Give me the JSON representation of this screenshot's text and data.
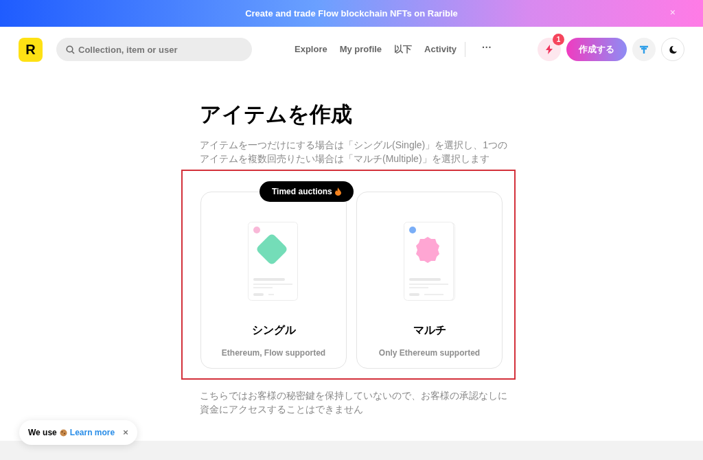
{
  "banner": {
    "text": "Create and trade Flow blockchain NFTs on Rarible",
    "close": "×"
  },
  "header": {
    "logo": "R",
    "search": {
      "placeholder": "Collection, item or user"
    },
    "nav": [
      "Explore",
      "My profile",
      "以下",
      "Activity"
    ],
    "more": "···",
    "notifications": "1",
    "create_button": "作成する"
  },
  "page": {
    "title": "アイテムを作成",
    "description": "アイテムを一つだけにする場合は「シングル(Single)」を選択し、1つのアイテムを複数回売りたい場合は「マルチ(Multiple)」を選択します",
    "options": [
      {
        "kind": "single",
        "title": "シングル",
        "subtitle": "Ethereum, Flow supported",
        "badge": "Timed auctions",
        "color": "#f9b8d8"
      },
      {
        "kind": "multiple",
        "title": "マルチ",
        "subtitle": "Only Ethereum supported",
        "color": "#7aaef7"
      }
    ],
    "footnote": "こちらではお客様の秘密鍵を保持していないので、お客様の承認なしに資金にアクセスすることはできません"
  },
  "cookie": {
    "text": "We use",
    "link": "Learn more",
    "close": "×"
  }
}
